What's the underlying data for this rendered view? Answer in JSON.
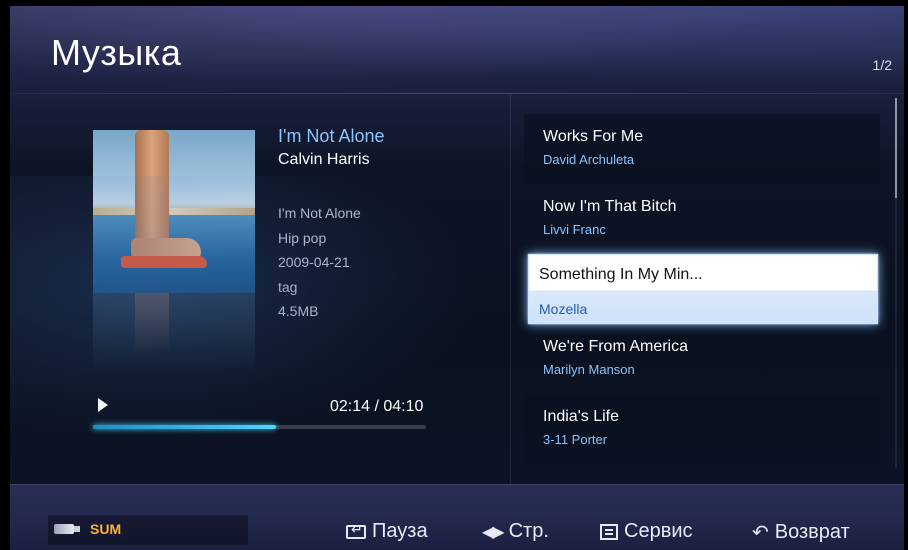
{
  "header": {
    "title": "Музыка",
    "page_indicator": "1/2"
  },
  "now_playing": {
    "track_title": "I'm Not Alone",
    "artist": "Calvin Harris",
    "meta": {
      "album": "I'm Not Alone",
      "genre": "Hip pop",
      "date": "2009-04-21",
      "tag": "tag",
      "size": "4.5MB"
    },
    "time_display": "02:14 / 04:10",
    "progress_fraction": 0.55
  },
  "playlist": {
    "items": [
      {
        "title": "Works For Me",
        "artist": "David Archuleta"
      },
      {
        "title": "Now I'm That Bitch",
        "artist": "Livvi Franc"
      },
      {
        "title": "Something In My Min...",
        "artist": "Mozella",
        "selected": true
      },
      {
        "title": "We're From America",
        "artist": "Marilyn Manson"
      },
      {
        "title": "India's Life",
        "artist": "3-11 Porter"
      }
    ]
  },
  "footer": {
    "device_label": "SUM",
    "hints": {
      "pause": "Пауза",
      "page": "Стр.",
      "tools": "Сервис",
      "return": "Возврат"
    }
  },
  "colors": {
    "accent": "#86c3ff",
    "device_label": "#ffb23a",
    "progress": "#4fd6ff"
  },
  "icons": {
    "play": "play-icon",
    "enter": "enter-icon",
    "left_right": "left-right-arrows-icon",
    "tools": "tools-icon",
    "return": "return-icon",
    "usb": "usb-icon"
  }
}
